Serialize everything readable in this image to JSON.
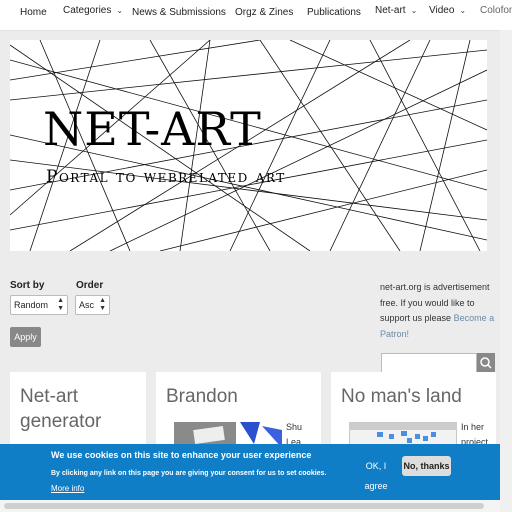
{
  "nav": {
    "items": [
      {
        "label": "Home",
        "dropdown": false
      },
      {
        "label": "Categories",
        "dropdown": true
      },
      {
        "label": "News & Submissions",
        "dropdown": false
      },
      {
        "label": "Orgz & Zines",
        "dropdown": false
      },
      {
        "label": "Publications",
        "dropdown": false
      },
      {
        "label": "Net-art",
        "dropdown": true
      },
      {
        "label": "Video",
        "dropdown": true
      },
      {
        "label": "Colofon",
        "dropdown": false
      }
    ]
  },
  "banner": {
    "title": "NET-ART",
    "subtitle": "Portal to webrelated art"
  },
  "filters": {
    "sort_label": "Sort by",
    "sort_value": "Random",
    "order_label": "Order",
    "order_value": "Asc",
    "apply_label": "Apply"
  },
  "sidebar": {
    "ad_text": "net-art.org is advertisement free. If you would like to support us please",
    "patron_link": "Become a Patron!"
  },
  "cards": [
    {
      "title": "Net-art generator",
      "snippet": ""
    },
    {
      "title": "Brandon",
      "snippet": "Shu Lea"
    },
    {
      "title": "No man's land",
      "snippet": "In her project"
    }
  ],
  "cookie": {
    "heading": "We use cookies on this site to enhance your user experience",
    "text": "By clicking any link on this page you are giving your consent for us to set cookies.",
    "more_info": "More info",
    "ok_label": "OK, I agree",
    "no_label": "No, thanks"
  },
  "colors": {
    "cookie_bg": "#0f7ec6",
    "apply_bg": "#888888",
    "patron_link": "#6b8aa8"
  }
}
